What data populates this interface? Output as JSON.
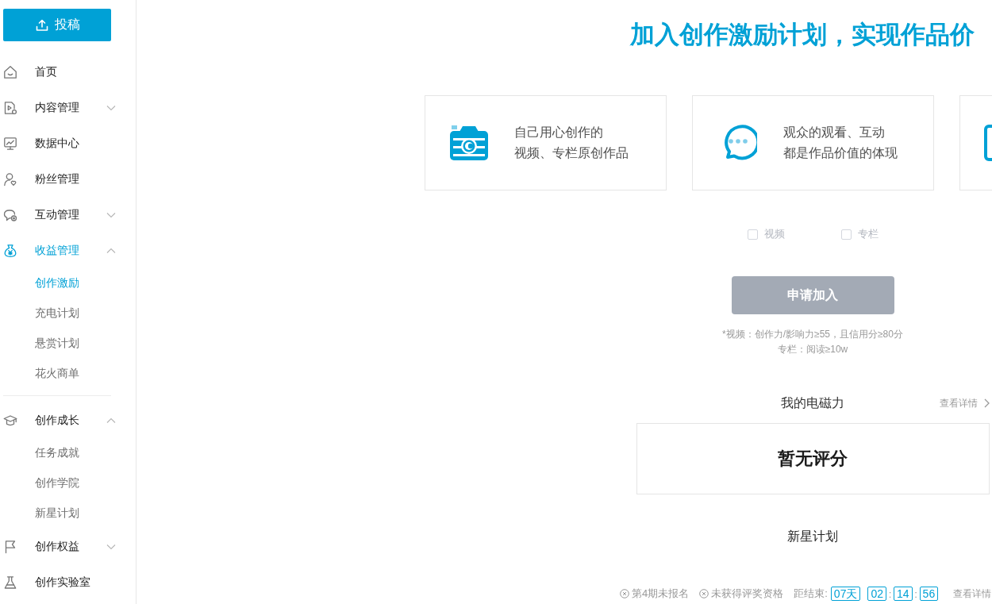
{
  "sidebar": {
    "upload_button": {
      "label": "投稿"
    },
    "groups": [
      {
        "items": [
          {
            "label": "首页",
            "selected": false
          },
          {
            "label": "内容管理",
            "selected": false,
            "expanded": false
          },
          {
            "label": "数据中心",
            "selected": false
          },
          {
            "label": "粉丝管理",
            "selected": false
          },
          {
            "label": "互动管理",
            "selected": false,
            "expanded": false
          },
          {
            "label": "收益管理",
            "selected": true,
            "expanded": true,
            "children": [
              {
                "label": "创作激励",
                "selected": true
              },
              {
                "label": "充电计划",
                "selected": false
              },
              {
                "label": "悬赏计划",
                "selected": false
              },
              {
                "label": "花火商单",
                "selected": false
              }
            ]
          }
        ]
      },
      {
        "items": [
          {
            "label": "创作成长",
            "selected": false,
            "expanded": true,
            "children": [
              {
                "label": "任务成就",
                "selected": false
              },
              {
                "label": "创作学院",
                "selected": false
              },
              {
                "label": "新星计划",
                "selected": false
              }
            ]
          },
          {
            "label": "创作权益",
            "selected": false,
            "expanded": false
          },
          {
            "label": "创作实验室",
            "selected": false
          }
        ]
      }
    ]
  },
  "main": {
    "title": "加入创作激励计划，实现作品价",
    "cards": [
      {
        "kind": "camera",
        "lines": [
          "自己用心创作的",
          "视频、专栏原创作品"
        ]
      },
      {
        "kind": "chat",
        "lines": [
          "观众的观看、互动",
          "都是作品价值的体现"
        ]
      },
      {
        "kind": "document"
      }
    ],
    "content_types": [
      {
        "label": "视频",
        "checked": false,
        "disabled": true
      },
      {
        "label": "专栏",
        "checked": false,
        "disabled": true
      }
    ],
    "apply_button": {
      "label": "申请加入",
      "disabled": true
    },
    "requirements": [
      "*视频：创作力/影响力≥55，且信用分≥80分",
      "专栏：阅读≥10w"
    ],
    "power": {
      "title": "我的电磁力",
      "link": "查看详情",
      "score": "暂无评分"
    },
    "new_star": {
      "title": "新星计划",
      "statuses": [
        {
          "label": "第4期未报名",
          "met": false
        },
        {
          "label": "未获得评奖资格",
          "met": false
        }
      ],
      "countdown": {
        "label": "距结束:",
        "days": "07天",
        "time": [
          "02",
          "14",
          "56"
        ],
        "separator": ":"
      },
      "link": "查看详情"
    }
  }
}
